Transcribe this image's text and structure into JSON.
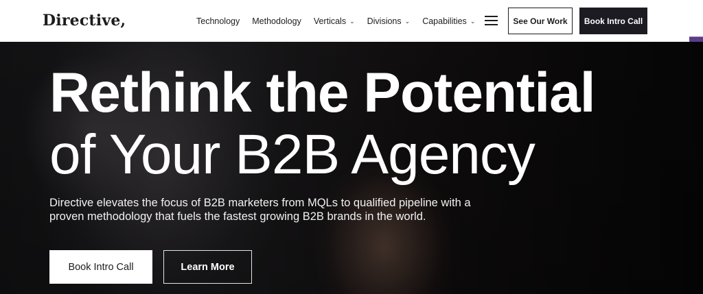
{
  "header": {
    "logo": "Directive,",
    "nav": [
      {
        "label": "Technology",
        "dropdown": false
      },
      {
        "label": "Methodology",
        "dropdown": false
      },
      {
        "label": "Verticals",
        "dropdown": true
      },
      {
        "label": "Divisions",
        "dropdown": true
      },
      {
        "label": "Capabilities",
        "dropdown": true
      }
    ],
    "menu_icon": "hamburger-icon",
    "see_work_label": "See Our Work",
    "book_call_label": "Book Intro Call"
  },
  "hero": {
    "headline_line1": "Rethink the Potential",
    "headline_line2": "of Your B2B Agency",
    "subtext": "Directive elevates the focus of B2B marketers from MQLs to qualified pipeline with a proven methodology that fuels the fastest growing B2B brands in the world.",
    "primary_cta": "Book Intro Call",
    "secondary_cta": "Learn More"
  },
  "colors": {
    "header_bg": "#ffffff",
    "dark_button": "#1c1b22",
    "accent": "#5b3d8a"
  }
}
